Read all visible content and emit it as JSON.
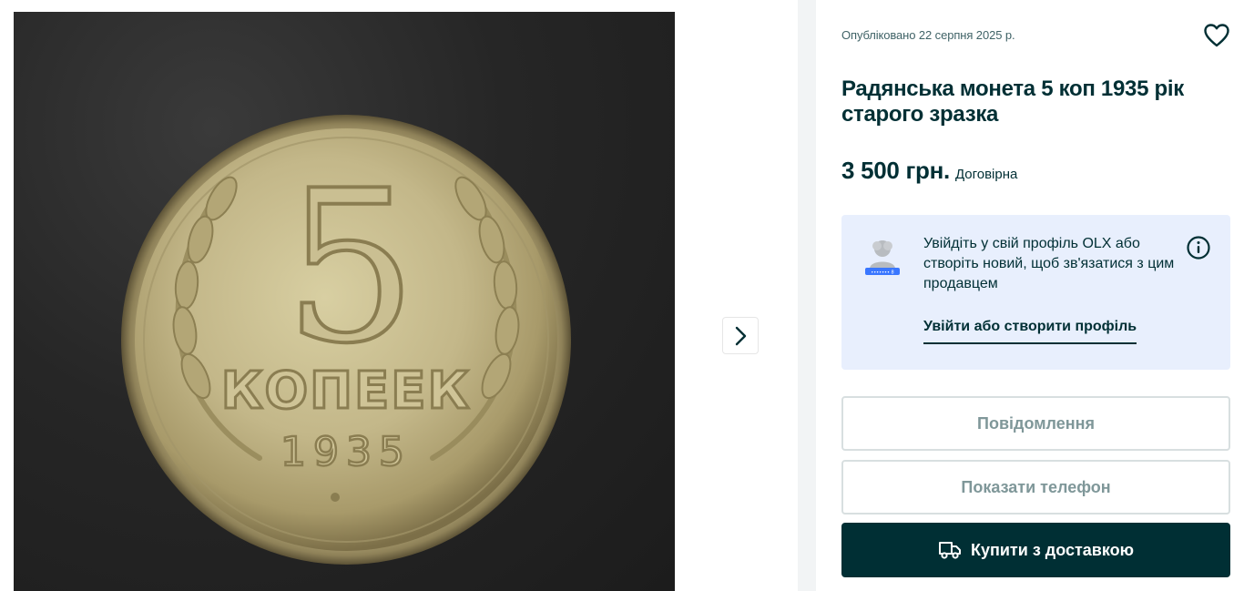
{
  "gallery": {
    "image_alt": "Радянська монета 5 копеек 1935",
    "next_icon": "chevron-right-icon"
  },
  "listing": {
    "published": "Опубліковано 22 серпня 2025 р.",
    "title": "Радянська монета 5 коп 1935 рік старого зразка",
    "price": "3 500 грн.",
    "negotiable": "Договірна",
    "favorite_icon": "heart-outline-icon"
  },
  "login_card": {
    "text": "Увійдіть у свій профіль OLX або створіть новий, щоб зв'язатися з цим продавцем",
    "link": "Увійти або створити профіль",
    "info_icon": "info-icon"
  },
  "actions": {
    "message": "Повідомлення",
    "show_phone": "Показати телефон",
    "buy_delivery": "Купити з доставкою",
    "buy_icon": "delivery-truck-icon"
  },
  "colors": {
    "primary": "#002f34",
    "card_bg": "#e8effd",
    "outline_border": "#d8dfe0",
    "outline_text": "#7f9799",
    "sidebar_divider": "#f2f4f5"
  }
}
